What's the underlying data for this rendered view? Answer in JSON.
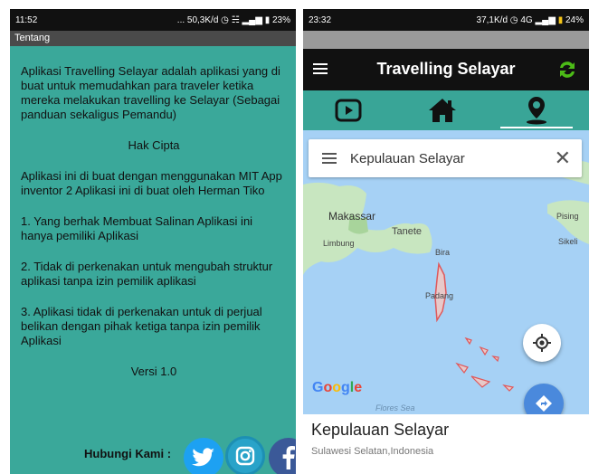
{
  "left": {
    "status": {
      "time": "11:52",
      "net": "... 50,3K/d",
      "battery": "23%"
    },
    "title": "Tentang",
    "paragraphs": [
      "Aplikasi Travelling Selayar adalah aplikasi yang di buat untuk memudahkan para traveler ketika mereka melakukan travelling  ke Selayar (Sebagai panduan sekaligus Pemandu)",
      "Hak Cipta",
      "Aplikasi ini di buat dengan menggunakan MIT App inventor 2 Aplikasi ini di buat oleh  Herman Tiko",
      "1. Yang berhak Membuat Salinan Aplikasi ini hanya pemiliki Aplikasi",
      "2. Tidak di perkenakan untuk mengubah struktur aplikasi tanpa izin pemilik aplikasi",
      "3. Aplikasi tidak di perkenakan untuk di perjual belikan dengan pihak ketiga tanpa izin pemilik Aplikasi",
      "Versi 1.0"
    ],
    "contact_label": "Hubungi Kami :",
    "social_icons": [
      "twitter-icon",
      "instagram-icon",
      "facebook-icon"
    ],
    "colors": {
      "background": "#3aa89a"
    }
  },
  "right": {
    "status": {
      "time": "23:32",
      "net": "37,1K/d",
      "network": "4G",
      "battery": "24%"
    },
    "app_title": "Travelling Selayar",
    "tabs": [
      "play-icon",
      "home-icon",
      "location-pin-icon"
    ],
    "search": {
      "value": "Kepulauan Selayar"
    },
    "map_labels": {
      "makassar": "Makassar",
      "tanete": "Tanete",
      "limbung": "Limbung",
      "bira": "Bira",
      "padang": "Padang",
      "pising": "Pising",
      "sikeli": "Sikeli",
      "flores": "Flores Sea"
    },
    "place": {
      "name": "Kepulauan Selayar",
      "region": "Sulawesi Selatan,Indonesia"
    },
    "google_letters": [
      "G",
      "o",
      "o",
      "g",
      "l",
      "e"
    ],
    "colors": {
      "accent": "#39a597",
      "fab_blue": "#4a89dc"
    }
  }
}
